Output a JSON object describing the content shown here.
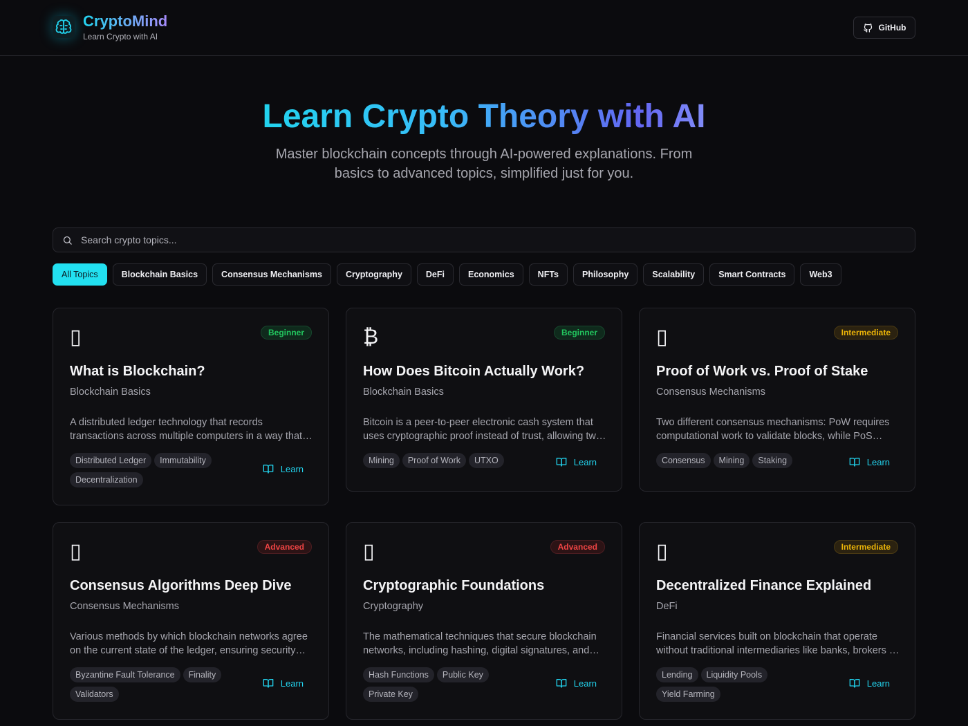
{
  "header": {
    "brand_name": "CryptoMind",
    "brand_tagline": "Learn Crypto with AI",
    "github_label": "GitHub"
  },
  "hero": {
    "title": "Learn Crypto Theory with AI",
    "subtitle": "Master blockchain concepts through AI-powered explanations. From basics to advanced topics, simplified just for you."
  },
  "search": {
    "placeholder": "Search crypto topics...",
    "value": ""
  },
  "filters": [
    "All Topics",
    "Blockchain Basics",
    "Consensus Mechanisms",
    "Cryptography",
    "DeFi",
    "Economics",
    "NFTs",
    "Philosophy",
    "Scalability",
    "Smart Contracts",
    "Web3"
  ],
  "active_filter": "All Topics",
  "cards": [
    {
      "icon": "▯",
      "level": "Beginner",
      "title": "What is Blockchain?",
      "category": "Blockchain Basics",
      "description": "A distributed ledger technology that records transactions across multiple computers in a way that makes them difficult to alter.",
      "tags": [
        "Distributed Ledger",
        "Immutability",
        "Decentralization"
      ],
      "action": "Learn"
    },
    {
      "icon": "₿",
      "level": "Beginner",
      "title": "How Does Bitcoin Actually Work?",
      "category": "Blockchain Basics",
      "description": "Bitcoin is a peer-to-peer electronic cash system that uses cryptographic proof instead of trust, allowing two parties to transact directly.",
      "tags": [
        "Mining",
        "Proof of Work",
        "UTXO"
      ],
      "action": "Learn"
    },
    {
      "icon": "▯",
      "level": "Intermediate",
      "title": "Proof of Work vs. Proof of Stake",
      "category": "Consensus Mechanisms",
      "description": "Two different consensus mechanisms: PoW requires computational work to validate blocks, while PoS selects validators by stake.",
      "tags": [
        "Consensus",
        "Mining",
        "Staking"
      ],
      "action": "Learn"
    },
    {
      "icon": "▯",
      "level": "Advanced",
      "title": "Consensus Algorithms Deep Dive",
      "category": "Consensus Mechanisms",
      "description": "Various methods by which blockchain networks agree on the current state of the ledger, ensuring security and consistency.",
      "tags": [
        "Byzantine Fault Tolerance",
        "Finality",
        "Validators"
      ],
      "action": "Learn"
    },
    {
      "icon": "▯",
      "level": "Advanced",
      "title": "Cryptographic Foundations",
      "category": "Cryptography",
      "description": "The mathematical techniques that secure blockchain networks, including hashing, digital signatures, and public key cryptography.",
      "tags": [
        "Hash Functions",
        "Public Key",
        "Private Key"
      ],
      "action": "Learn"
    },
    {
      "icon": "▯",
      "level": "Intermediate",
      "title": "Decentralized Finance Explained",
      "category": "DeFi",
      "description": "Financial services built on blockchain that operate without traditional intermediaries like banks, brokers or exchanges.",
      "tags": [
        "Lending",
        "Liquidity Pools",
        "Yield Farming"
      ],
      "action": "Learn"
    }
  ]
}
